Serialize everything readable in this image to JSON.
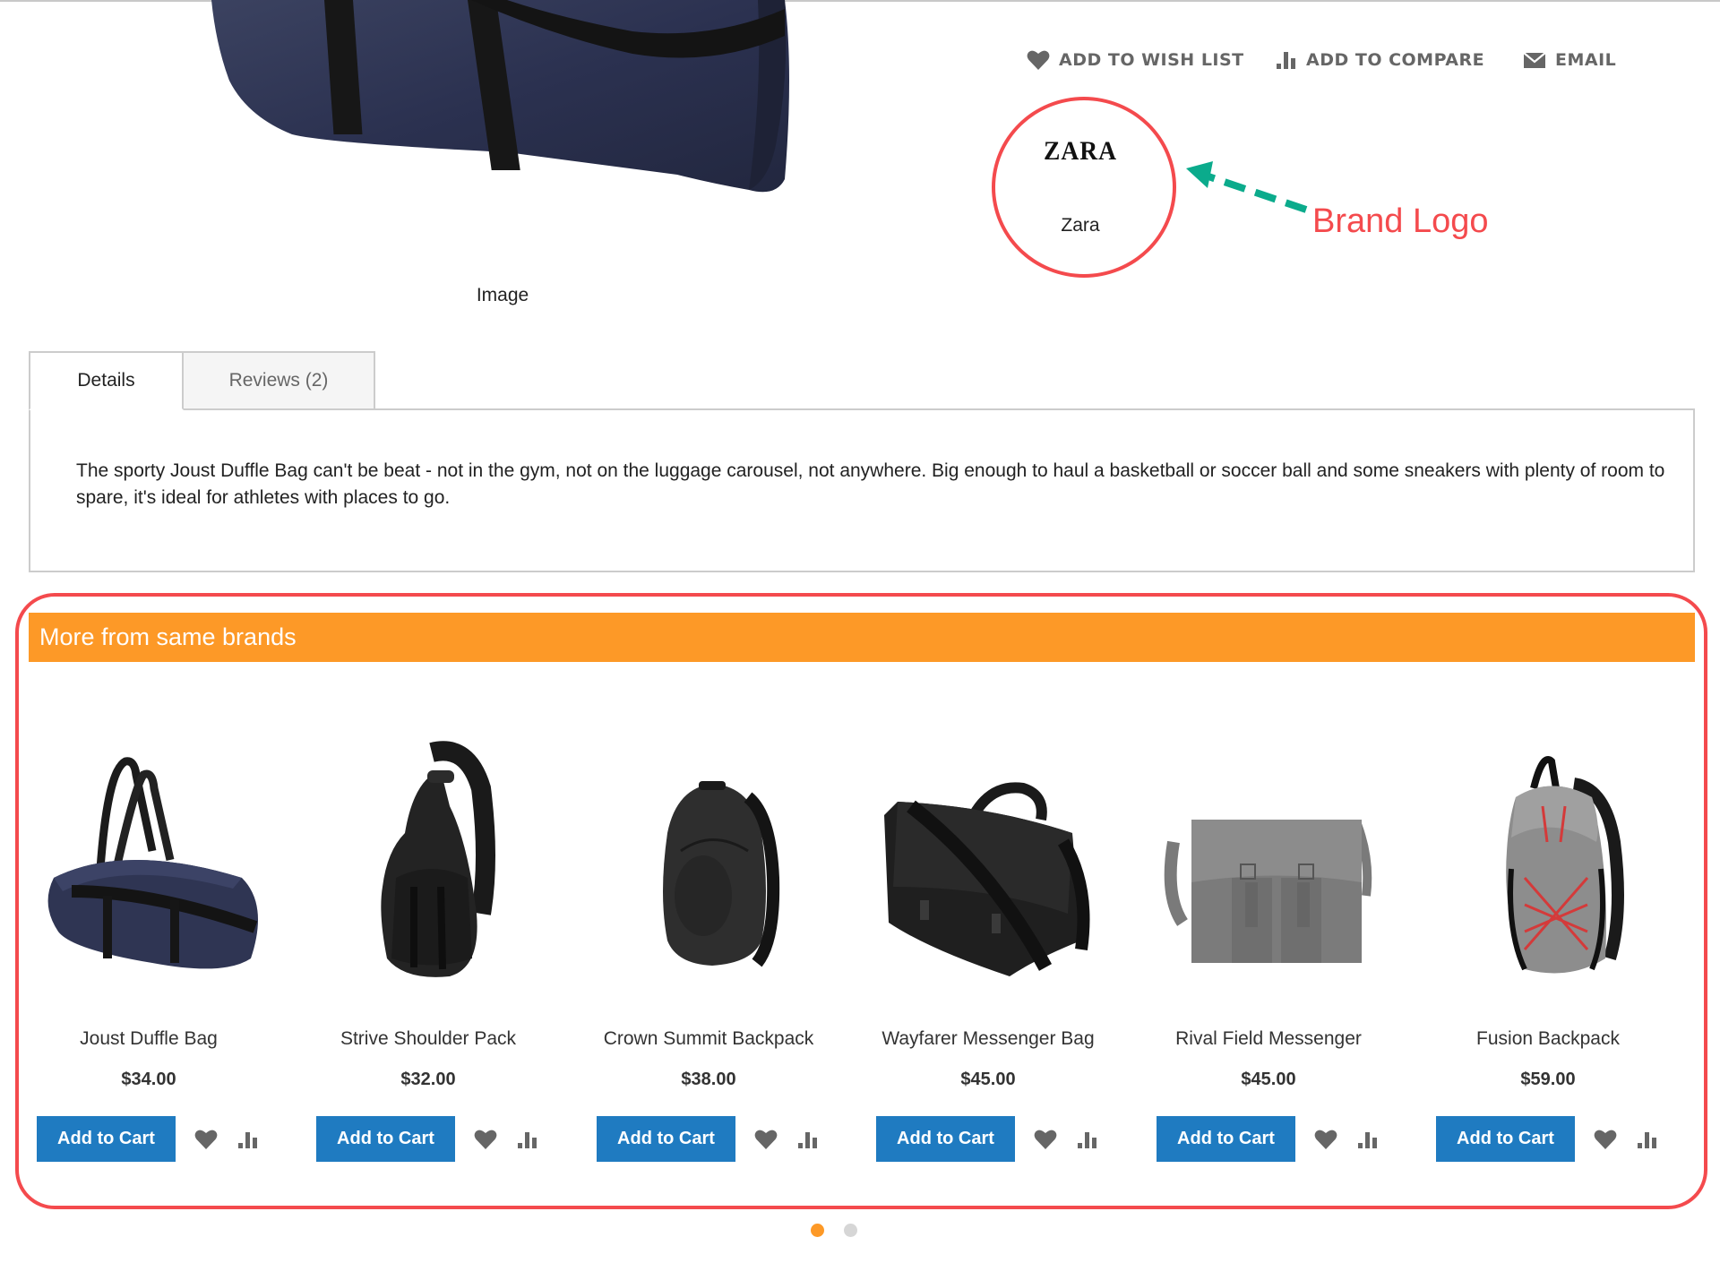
{
  "product_media": {
    "image_caption": "Image",
    "image_icon": "duffle-bag-image"
  },
  "actions": [
    {
      "label": "ADD TO WISH LIST",
      "icon": "heart-icon"
    },
    {
      "label": "ADD TO COMPARE",
      "icon": "bar-chart-icon"
    },
    {
      "label": "EMAIL",
      "icon": "envelope-icon"
    }
  ],
  "brand": {
    "logo_text": "ZARA",
    "name": "Zara",
    "annotation": "Brand Logo"
  },
  "tabs": [
    {
      "label": "Details",
      "active": true
    },
    {
      "label": "Reviews (2)",
      "active": false
    }
  ],
  "details": {
    "description": "The sporty Joust Duffle Bag can't be beat - not in the gym, not on the luggage carousel, not anywhere. Big enough to haul a basketball or soccer ball and some sneakers with plenty of room to spare, it's ideal for athletes with places to go."
  },
  "brand_products": {
    "title": "More from same brands",
    "add_to_cart_label": "Add to Cart",
    "items": [
      {
        "name": "Joust Duffle Bag",
        "price": "$34.00",
        "image": "duffle-bag"
      },
      {
        "name": "Strive Shoulder Pack",
        "price": "$32.00",
        "image": "sling-pack"
      },
      {
        "name": "Crown Summit Backpack",
        "price": "$38.00",
        "image": "backpack"
      },
      {
        "name": "Wayfarer Messenger Bag",
        "price": "$45.00",
        "image": "messenger-bag"
      },
      {
        "name": "Rival Field Messenger",
        "price": "$45.00",
        "image": "field-messenger"
      },
      {
        "name": "Fusion Backpack",
        "price": "$59.00",
        "image": "fusion-backpack"
      }
    ],
    "pagination": {
      "pages": 2,
      "current": 1
    }
  },
  "colors": {
    "accent_orange": "#fd9927",
    "button_blue": "#1f7bc1",
    "annotation_red": "#f44a4d",
    "annotation_arrow": "#0bab8c",
    "icon_gray": "#666666"
  }
}
